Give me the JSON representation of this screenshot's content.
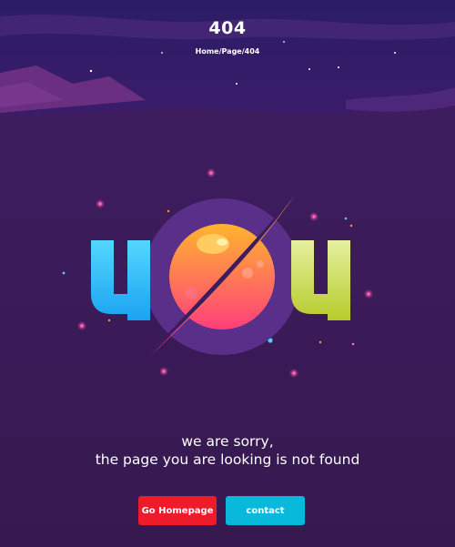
{
  "header": {
    "title": "404",
    "breadcrumb": "Home/Page/404"
  },
  "illustration": {
    "digits": [
      "4",
      "0",
      "4"
    ],
    "icons": [
      "planet-icon",
      "moon-crescent-icon",
      "star-icon"
    ]
  },
  "message": {
    "line1": "we are sorry,",
    "line2": "the page you are looking is not found"
  },
  "buttons": {
    "home_label": "Go Homepage",
    "contact_label": "contact"
  },
  "colors": {
    "background": "#3a1c5a",
    "header_sky": "#2e1a63",
    "primary_button": "#ee1c2b",
    "secondary_button": "#08b9dc",
    "digit_left": "#3ec6f5",
    "digit_right": "#c7d93a",
    "planet_top": "#ffb52e",
    "planet_bottom": "#ff4b7a"
  }
}
